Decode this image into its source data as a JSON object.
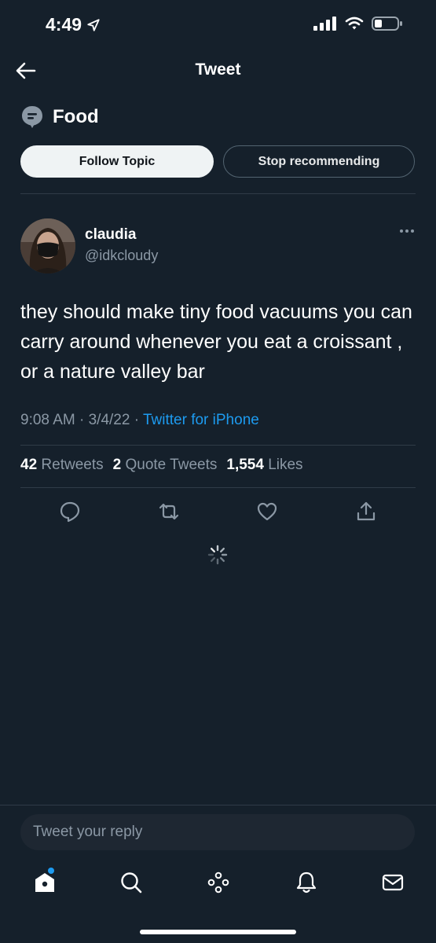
{
  "status_bar": {
    "time": "4:49"
  },
  "nav": {
    "title": "Tweet"
  },
  "topic": {
    "name": "Food",
    "follow_label": "Follow Topic",
    "stop_label": "Stop recommending"
  },
  "tweet": {
    "author_name": "claudia",
    "author_handle": "@idkcloudy",
    "text": "they should make tiny food vacuums you can carry around whenever you eat a croissant , or a nature valley bar",
    "time": "9:08 AM",
    "date": "3/4/22",
    "separator": "·",
    "source": "Twitter for iPhone"
  },
  "stats": {
    "retweets_count": "42",
    "retweets_label": "Retweets",
    "quotes_count": "2",
    "quotes_label": "Quote Tweets",
    "likes_count": "1,554",
    "likes_label": "Likes"
  },
  "reply": {
    "placeholder": "Tweet your reply"
  },
  "colors": {
    "background": "#15202b",
    "accent": "#1d9bf0",
    "secondary_text": "#8b98a5"
  }
}
